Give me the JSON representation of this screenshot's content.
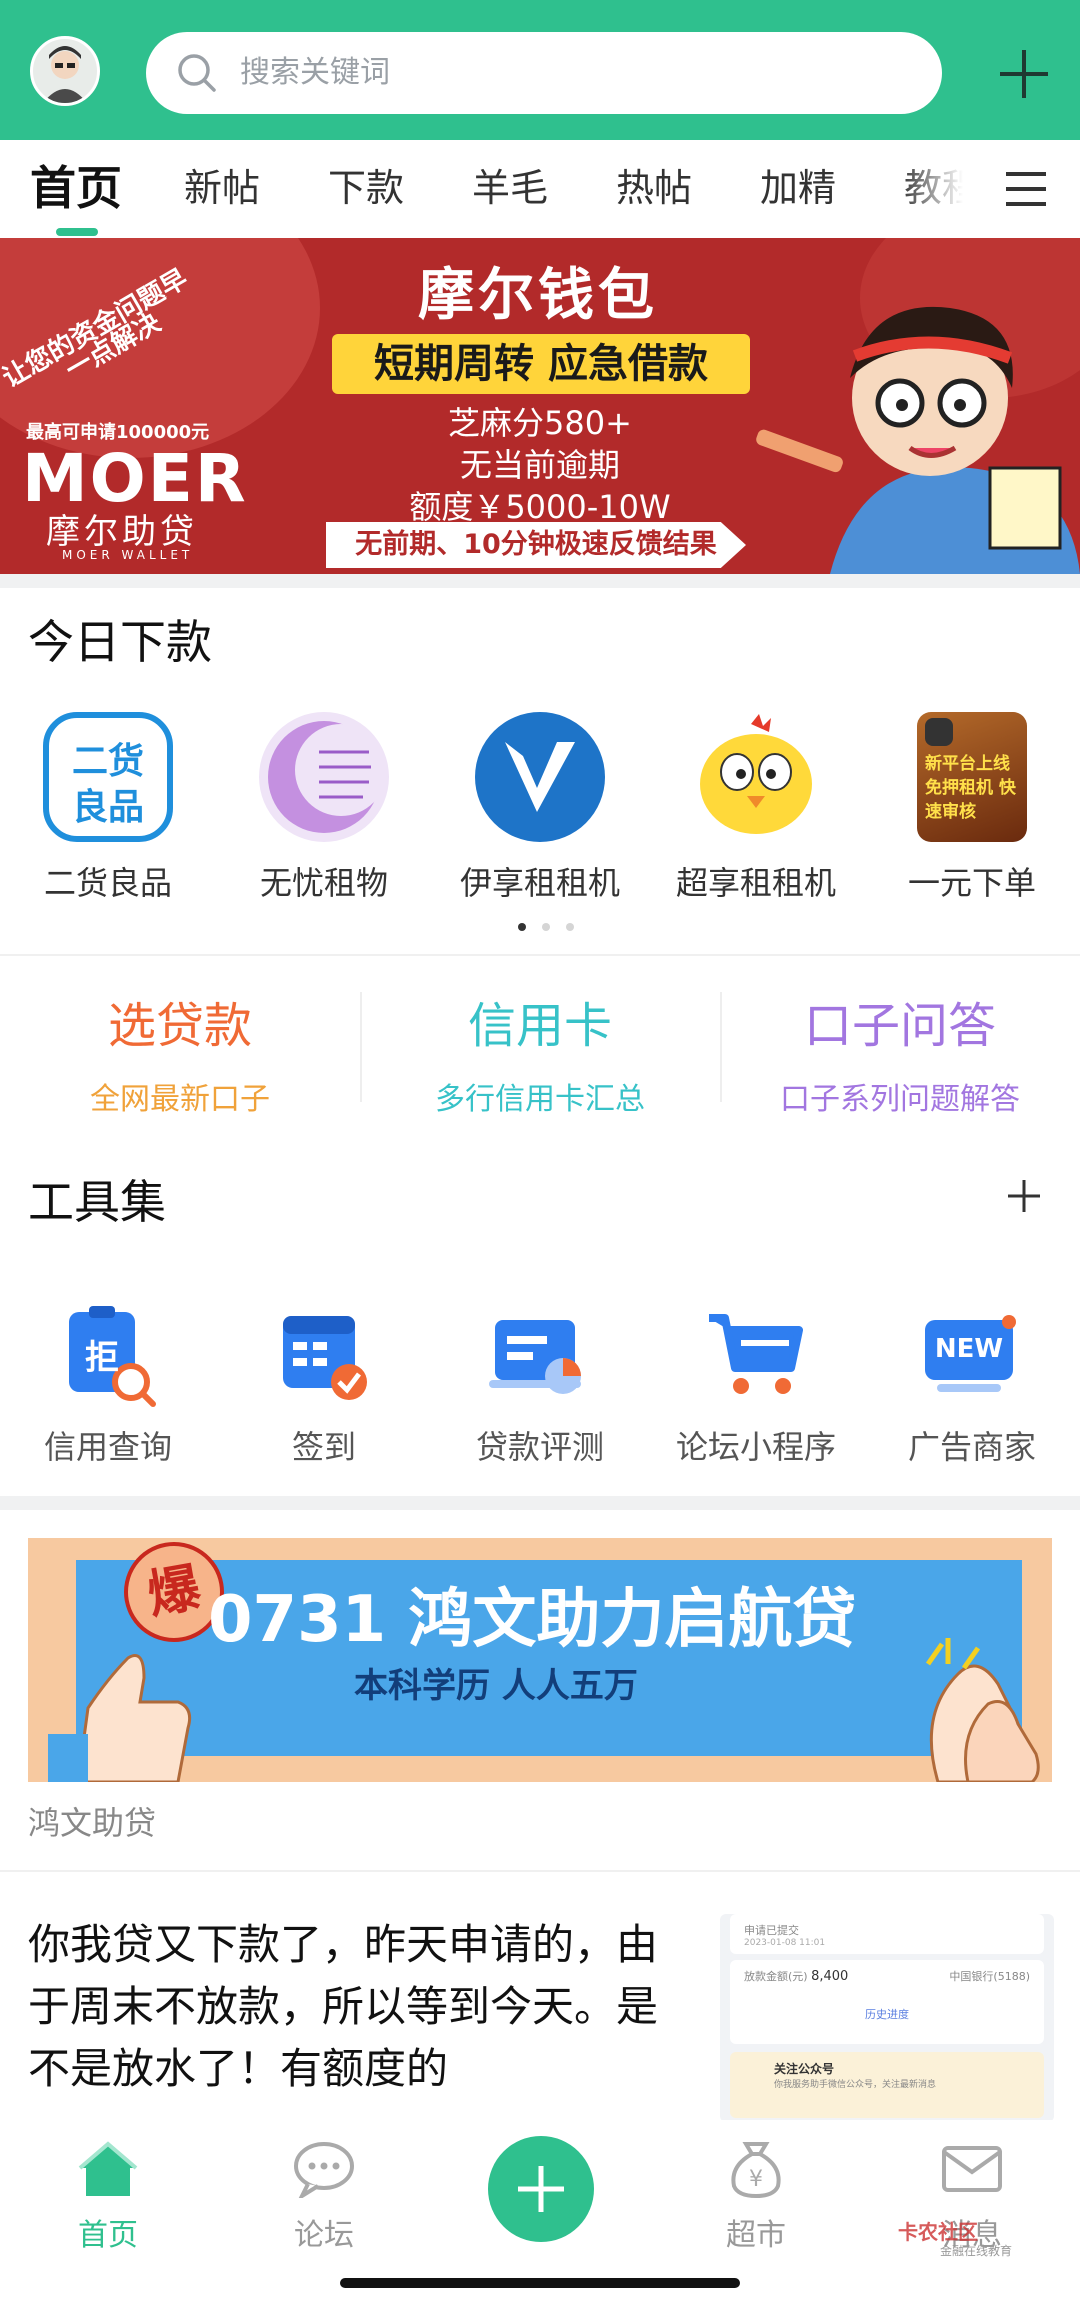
{
  "search": {
    "placeholder": "搜索关键词"
  },
  "tabs": [
    {
      "label": "首页",
      "active": true
    },
    {
      "label": "新帖"
    },
    {
      "label": "下款"
    },
    {
      "label": "羊毛"
    },
    {
      "label": "热帖"
    },
    {
      "label": "加精"
    },
    {
      "label": "教程"
    }
  ],
  "banner1": {
    "diagonal_1": "让您的资金问题早",
    "diagonal_2": "一点解决",
    "small": "最高可申请100000元",
    "brand": "MOER",
    "brand_cn": "摩尔助贷",
    "brand_en": "MOER WALLET",
    "title": "摩尔钱包",
    "highlight": "短期周转  应急借款",
    "line1": "芝麻分580+",
    "line2": "无当前逾期",
    "line3": "额度￥5000-10W",
    "bottom": "无前期、10分钟极速反馈结果"
  },
  "today": {
    "title": "今日下款",
    "apps": [
      {
        "label": "二货良品",
        "icon": "ergoods-icon",
        "icon_text_1": "二货",
        "icon_text_2": "良品"
      },
      {
        "label": "无忧租物",
        "icon": "wuyou-icon"
      },
      {
        "label": "伊享租租机",
        "icon": "yixiang-icon"
      },
      {
        "label": "超享租租机",
        "icon": "chick-icon"
      },
      {
        "label": "一元下单",
        "icon": "phone-promo-icon",
        "icon_text": "新平台上线 免押租机 快速审核"
      }
    ],
    "page_count": 3,
    "page_active": 1
  },
  "links": [
    {
      "title": "选贷款",
      "sub": "全网最新口子",
      "title_color": "#f06a35",
      "sub_color": "#f0a23a"
    },
    {
      "title": "信用卡",
      "sub": "多行信用卡汇总",
      "title_color": "#37c2c8",
      "sub_color": "#37c2c8"
    },
    {
      "title": "口子问答",
      "sub": "口子系列问题解答",
      "title_color": "#a276e0",
      "sub_color": "#a276e0"
    }
  ],
  "tools": {
    "title": "工具集",
    "items": [
      {
        "label": "信用查询",
        "icon": "credit-query-icon",
        "icon_text": "拒"
      },
      {
        "label": "签到",
        "icon": "checkin-icon"
      },
      {
        "label": "贷款评测",
        "icon": "loan-eval-icon"
      },
      {
        "label": "论坛小程序",
        "icon": "cart-icon"
      },
      {
        "label": "广告商家",
        "icon": "new-ad-icon",
        "icon_text": "NEW"
      }
    ]
  },
  "banner2": {
    "bao": "爆",
    "main": "0731  鸿文助力启航贷",
    "sub": "本科学历    人人五万",
    "caption": "鸿文助贷"
  },
  "post": {
    "text": "你我贷又下款了，昨天申请的，由于周末不放款，所以等到今天。是不是放水了！有额度的",
    "thumb_line1": "申请已提交",
    "thumb_line2": "2023-01-08 11:01",
    "thumb_amount_label": "放款金额(元)",
    "thumb_amount": "8,400",
    "thumb_bank": "中国银行(5188)",
    "thumb_history": "历史进度",
    "thumb_follow": "关注公众号",
    "thumb_follow_sub": "你我服务助手微信公众号，关注最新消息"
  },
  "bottom_nav": [
    {
      "label": "首页",
      "icon": "home-icon",
      "active": true
    },
    {
      "label": "论坛",
      "icon": "chat-icon"
    },
    {
      "label": "",
      "icon": "plus-icon"
    },
    {
      "label": "超市",
      "icon": "money-bag-icon"
    },
    {
      "label": "消息",
      "icon": "mail-icon"
    }
  ],
  "watermark": {
    "text": "卡农社区",
    "sub": "金融在线教育"
  },
  "colors": {
    "brand_green": "#2fc08e"
  }
}
